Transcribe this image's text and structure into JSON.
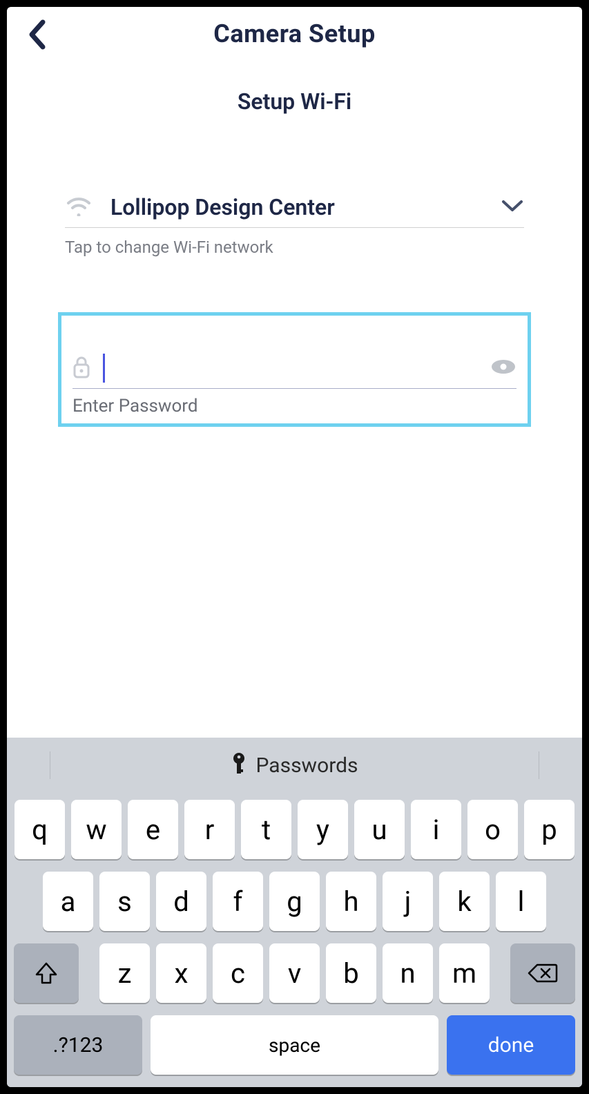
{
  "header": {
    "title": "Camera Setup",
    "subtitle": "Setup Wi-Fi"
  },
  "wifi": {
    "selected_network": "Lollipop Design Center",
    "change_hint": "Tap to change Wi-Fi network"
  },
  "password": {
    "value": "",
    "hint": "Enter Password"
  },
  "keyboard": {
    "suggestion_label": "Passwords",
    "row1": [
      "q",
      "w",
      "e",
      "r",
      "t",
      "y",
      "u",
      "i",
      "o",
      "p"
    ],
    "row2": [
      "a",
      "s",
      "d",
      "f",
      "g",
      "h",
      "j",
      "k",
      "l"
    ],
    "row3": [
      "z",
      "x",
      "c",
      "v",
      "b",
      "n",
      "m"
    ],
    "numswitch_label": ".?123",
    "space_label": "space",
    "done_label": "done"
  }
}
